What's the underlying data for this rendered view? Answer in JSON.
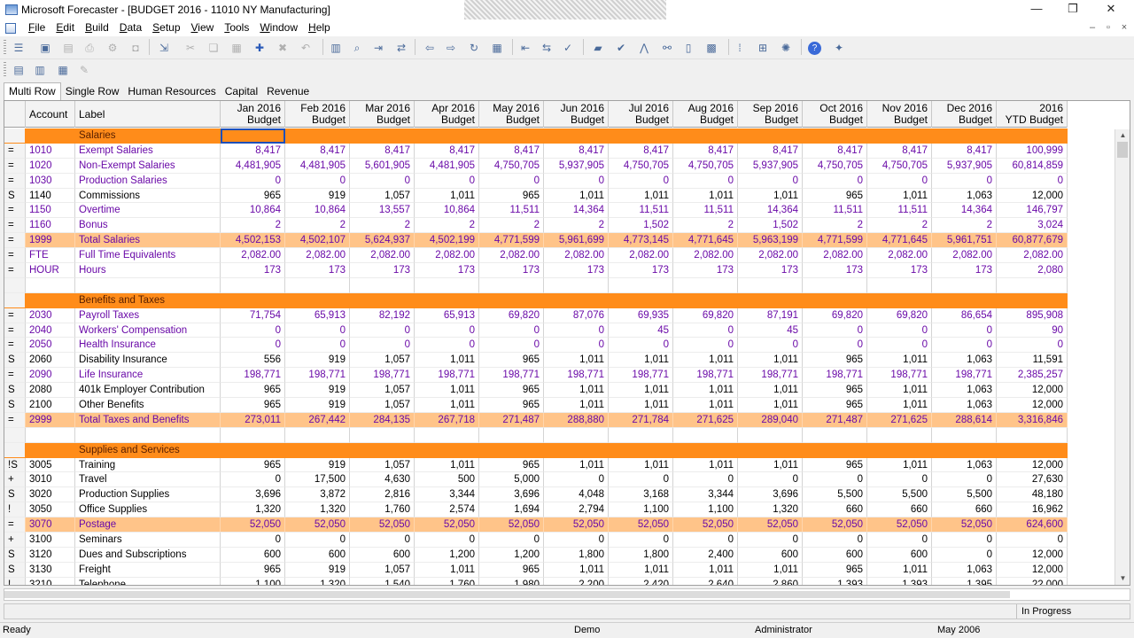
{
  "window": {
    "title": "Microsoft Forecaster - [BUDGET 2016 - 11010 NY Manufacturing]",
    "minimize_glyph": "—",
    "restore_glyph": "❐",
    "close_glyph": "✕"
  },
  "menu": {
    "items": [
      "File",
      "Edit",
      "Build",
      "Data",
      "Setup",
      "View",
      "Tools",
      "Window",
      "Help"
    ],
    "mdi_minimize_glyph": "–",
    "mdi_restore_glyph": "▫",
    "mdi_close_glyph": "×"
  },
  "toolbar": {
    "icons": [
      "list-view-icon",
      "save-icon",
      "print-preview-icon",
      "print-icon",
      "user-settings-icon",
      "disk-icon",
      "export-icon",
      "cut-icon",
      "copy-icon",
      "paste-icon",
      "add-icon",
      "delete-icon",
      "undo-icon",
      "grid-icon",
      "find-icon",
      "insert-row-icon",
      "move-icon",
      "back-icon",
      "forward-icon",
      "refresh-icon",
      "table-icon",
      "collapse-icon",
      "expand-icon",
      "spell-icon",
      "folder-icon",
      "check-icon",
      "chart-icon",
      "link-icon",
      "book-icon",
      "calc-icon",
      "dots-icon",
      "drill-icon",
      "settings-icon",
      "help-icon",
      "tips-icon"
    ]
  },
  "tabs": [
    "Multi Row",
    "Single Row",
    "Human Resources",
    "Capital",
    "Revenue"
  ],
  "grid": {
    "headers": {
      "account": "Account",
      "label": "Label",
      "months": [
        [
          "Jan 2016",
          "Budget"
        ],
        [
          "Feb 2016",
          "Budget"
        ],
        [
          "Mar 2016",
          "Budget"
        ],
        [
          "Apr 2016",
          "Budget"
        ],
        [
          "May 2016",
          "Budget"
        ],
        [
          "Jun 2016",
          "Budget"
        ],
        [
          "Jul 2016",
          "Budget"
        ],
        [
          "Aug 2016",
          "Budget"
        ],
        [
          "Sep 2016",
          "Budget"
        ],
        [
          "Oct 2016",
          "Budget"
        ],
        [
          "Nov 2016",
          "Budget"
        ],
        [
          "Dec 2016",
          "Budget"
        ],
        [
          "2016",
          "YTD Budget"
        ]
      ]
    },
    "rows": [
      {
        "type": "section",
        "label": "Salaries"
      },
      {
        "sym": "=",
        "acct": "1010",
        "label": "Exempt Salaries",
        "color": "purple",
        "values": [
          "8,417",
          "8,417",
          "8,417",
          "8,417",
          "8,417",
          "8,417",
          "8,417",
          "8,417",
          "8,417",
          "8,417",
          "8,417",
          "8,417",
          "100,999"
        ]
      },
      {
        "sym": "=",
        "acct": "1020",
        "label": "Non-Exempt Salaries",
        "color": "purple",
        "values": [
          "4,481,905",
          "4,481,905",
          "5,601,905",
          "4,481,905",
          "4,750,705",
          "5,937,905",
          "4,750,705",
          "4,750,705",
          "5,937,905",
          "4,750,705",
          "4,750,705",
          "5,937,905",
          "60,814,859"
        ]
      },
      {
        "sym": "=",
        "acct": "1030",
        "label": "Production Salaries",
        "color": "purple",
        "values": [
          "0",
          "0",
          "0",
          "0",
          "0",
          "0",
          "0",
          "0",
          "0",
          "0",
          "0",
          "0",
          "0"
        ]
      },
      {
        "sym": "S",
        "acct": "1140",
        "label": "Commissions",
        "color": "black",
        "values": [
          "965",
          "919",
          "1,057",
          "1,011",
          "965",
          "1,011",
          "1,011",
          "1,011",
          "1,011",
          "965",
          "1,011",
          "1,063",
          "12,000"
        ]
      },
      {
        "sym": "=",
        "acct": "1150",
        "label": "Overtime",
        "color": "purple",
        "values": [
          "10,864",
          "10,864",
          "13,557",
          "10,864",
          "11,511",
          "14,364",
          "11,511",
          "11,511",
          "14,364",
          "11,511",
          "11,511",
          "14,364",
          "146,797"
        ]
      },
      {
        "sym": "=",
        "acct": "1160",
        "label": "Bonus",
        "color": "purple",
        "values": [
          "2",
          "2",
          "2",
          "2",
          "2",
          "2",
          "1,502",
          "2",
          "1,502",
          "2",
          "2",
          "2",
          "3,024"
        ]
      },
      {
        "type": "total",
        "sym": "=",
        "acct": "1999",
        "label": "Total Salaries",
        "values": [
          "4,502,153",
          "4,502,107",
          "5,624,937",
          "4,502,199",
          "4,771,599",
          "5,961,699",
          "4,773,145",
          "4,771,645",
          "5,963,199",
          "4,771,599",
          "4,771,645",
          "5,961,751",
          "60,877,679"
        ]
      },
      {
        "sym": "=",
        "acct": "FTE",
        "label": "Full Time Equivalents",
        "color": "purple",
        "values": [
          "2,082.00",
          "2,082.00",
          "2,082.00",
          "2,082.00",
          "2,082.00",
          "2,082.00",
          "2,082.00",
          "2,082.00",
          "2,082.00",
          "2,082.00",
          "2,082.00",
          "2,082.00",
          "2,082.00"
        ]
      },
      {
        "sym": "=",
        "acct": "HOUR",
        "label": "Hours",
        "color": "purple",
        "values": [
          "173",
          "173",
          "173",
          "173",
          "173",
          "173",
          "173",
          "173",
          "173",
          "173",
          "173",
          "173",
          "2,080"
        ]
      },
      {
        "type": "blank"
      },
      {
        "type": "section",
        "label": "Benefits and Taxes"
      },
      {
        "sym": "=",
        "acct": "2030",
        "label": "Payroll Taxes",
        "color": "purple",
        "values": [
          "71,754",
          "65,913",
          "82,192",
          "65,913",
          "69,820",
          "87,076",
          "69,935",
          "69,820",
          "87,191",
          "69,820",
          "69,820",
          "86,654",
          "895,908"
        ]
      },
      {
        "sym": "=",
        "acct": "2040",
        "label": "Workers' Compensation",
        "color": "purple",
        "values": [
          "0",
          "0",
          "0",
          "0",
          "0",
          "0",
          "45",
          "0",
          "45",
          "0",
          "0",
          "0",
          "90"
        ]
      },
      {
        "sym": "=",
        "acct": "2050",
        "label": "Health Insurance",
        "color": "purple",
        "values": [
          "0",
          "0",
          "0",
          "0",
          "0",
          "0",
          "0",
          "0",
          "0",
          "0",
          "0",
          "0",
          "0"
        ]
      },
      {
        "sym": "S",
        "acct": "2060",
        "label": "Disability Insurance",
        "color": "black",
        "values": [
          "556",
          "919",
          "1,057",
          "1,011",
          "965",
          "1,011",
          "1,011",
          "1,011",
          "1,011",
          "965",
          "1,011",
          "1,063",
          "11,591"
        ]
      },
      {
        "sym": "=",
        "acct": "2090",
        "label": "Life Insurance",
        "color": "purple",
        "values": [
          "198,771",
          "198,771",
          "198,771",
          "198,771",
          "198,771",
          "198,771",
          "198,771",
          "198,771",
          "198,771",
          "198,771",
          "198,771",
          "198,771",
          "2,385,257"
        ]
      },
      {
        "sym": "S",
        "acct": "2080",
        "label": "401k Employer Contribution",
        "color": "black",
        "values": [
          "965",
          "919",
          "1,057",
          "1,011",
          "965",
          "1,011",
          "1,011",
          "1,011",
          "1,011",
          "965",
          "1,011",
          "1,063",
          "12,000"
        ]
      },
      {
        "sym": "S",
        "acct": "2100",
        "label": "Other Benefits",
        "color": "black",
        "values": [
          "965",
          "919",
          "1,057",
          "1,011",
          "965",
          "1,011",
          "1,011",
          "1,011",
          "1,011",
          "965",
          "1,011",
          "1,063",
          "12,000"
        ]
      },
      {
        "type": "total",
        "sym": "=",
        "acct": "2999",
        "label": "Total Taxes and Benefits",
        "values": [
          "273,011",
          "267,442",
          "284,135",
          "267,718",
          "271,487",
          "288,880",
          "271,784",
          "271,625",
          "289,040",
          "271,487",
          "271,625",
          "288,614",
          "3,316,846"
        ]
      },
      {
        "type": "blank"
      },
      {
        "type": "section",
        "label": "Supplies and Services"
      },
      {
        "sym": "!S",
        "acct": "3005",
        "label": "Training",
        "color": "black",
        "values": [
          "965",
          "919",
          "1,057",
          "1,011",
          "965",
          "1,011",
          "1,011",
          "1,011",
          "1,011",
          "965",
          "1,011",
          "1,063",
          "12,000"
        ]
      },
      {
        "sym": "+",
        "acct": "3010",
        "label": "Travel",
        "color": "black",
        "values": [
          "0",
          "17,500",
          "4,630",
          "500",
          "5,000",
          "0",
          "0",
          "0",
          "0",
          "0",
          "0",
          "0",
          "27,630"
        ]
      },
      {
        "sym": "S",
        "acct": "3020",
        "label": "Production Supplies",
        "color": "black",
        "values": [
          "3,696",
          "3,872",
          "2,816",
          "3,344",
          "3,696",
          "4,048",
          "3,168",
          "3,344",
          "3,696",
          "5,500",
          "5,500",
          "5,500",
          "48,180"
        ]
      },
      {
        "sym": "!",
        "acct": "3050",
        "label": "Office Supplies",
        "color": "black",
        "values": [
          "1,320",
          "1,320",
          "1,760",
          "2,574",
          "1,694",
          "2,794",
          "1,100",
          "1,100",
          "1,320",
          "660",
          "660",
          "660",
          "16,962"
        ]
      },
      {
        "type": "total",
        "sym": "=",
        "acct": "3070",
        "label": "Postage",
        "values": [
          "52,050",
          "52,050",
          "52,050",
          "52,050",
          "52,050",
          "52,050",
          "52,050",
          "52,050",
          "52,050",
          "52,050",
          "52,050",
          "52,050",
          "624,600"
        ]
      },
      {
        "sym": "+",
        "acct": "3100",
        "label": "Seminars",
        "color": "black",
        "values": [
          "0",
          "0",
          "0",
          "0",
          "0",
          "0",
          "0",
          "0",
          "0",
          "0",
          "0",
          "0",
          "0"
        ]
      },
      {
        "sym": "S",
        "acct": "3120",
        "label": "Dues and Subscriptions",
        "color": "black",
        "values": [
          "600",
          "600",
          "600",
          "1,200",
          "1,200",
          "1,800",
          "1,800",
          "2,400",
          "600",
          "600",
          "600",
          "0",
          "12,000"
        ]
      },
      {
        "sym": "S",
        "acct": "3130",
        "label": "Freight",
        "color": "black",
        "values": [
          "965",
          "919",
          "1,057",
          "1,011",
          "965",
          "1,011",
          "1,011",
          "1,011",
          "1,011",
          "965",
          "1,011",
          "1,063",
          "12,000"
        ]
      },
      {
        "sym": "!",
        "acct": "3210",
        "label": "Telephone",
        "color": "black",
        "values": [
          "1,100",
          "1,320",
          "1,540",
          "1,760",
          "1,980",
          "2,200",
          "2,420",
          "2,640",
          "2,860",
          "1,393",
          "1,393",
          "1,395",
          "22,000"
        ]
      }
    ]
  },
  "scroll": {
    "up_glyph": "▲",
    "down_glyph": "▼"
  },
  "info": {
    "progress_status": "In Progress"
  },
  "status": {
    "ready": "Ready",
    "company": "Demo",
    "user": "Administrator",
    "period": "May 2006"
  }
}
